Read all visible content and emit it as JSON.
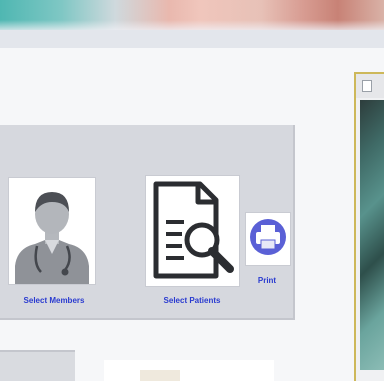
{
  "panel": {
    "buttons": [
      {
        "label": "Select Members",
        "icon": "doctor-avatar-icon"
      },
      {
        "label": "Select Patients",
        "icon": "document-search-icon"
      },
      {
        "label": "Print",
        "icon": "printer-icon"
      }
    ]
  },
  "colors": {
    "label_blue": "#2a3bd0",
    "panel_gray": "#d6d8de",
    "print_circle": "#5a60d6"
  }
}
